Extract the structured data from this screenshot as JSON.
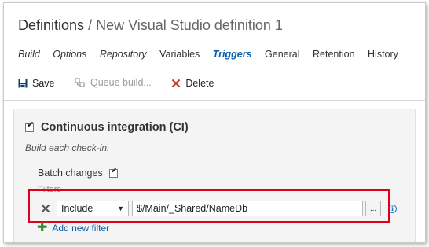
{
  "header": {
    "breadcrumb_root": "Definitions",
    "breadcrumb_sep": "/",
    "definition_name": "New Visual Studio definition 1"
  },
  "tabs": [
    {
      "label": "Build"
    },
    {
      "label": "Options"
    },
    {
      "label": "Repository"
    },
    {
      "label": "Variables"
    },
    {
      "label": "Triggers"
    },
    {
      "label": "General"
    },
    {
      "label": "Retention"
    },
    {
      "label": "History"
    }
  ],
  "active_tab": "Triggers",
  "toolbar": {
    "save_label": "Save",
    "queue_label": "Queue build...",
    "delete_label": "Delete"
  },
  "ci": {
    "checked": true,
    "label": "Continuous integration (CI)",
    "description": "Build each check-in.",
    "batch_label": "Batch changes",
    "batch_checked": true,
    "filters_label": "Filters",
    "filter": {
      "type": "Include",
      "path": "$/Main/_Shared/NameDb",
      "browse_label": "..."
    },
    "add_filter_label": "Add new filter"
  },
  "colors": {
    "accent": "#0b5ca7",
    "highlight": "#e0001b",
    "add": "#2e8b2e",
    "delete": "#c0392b"
  }
}
